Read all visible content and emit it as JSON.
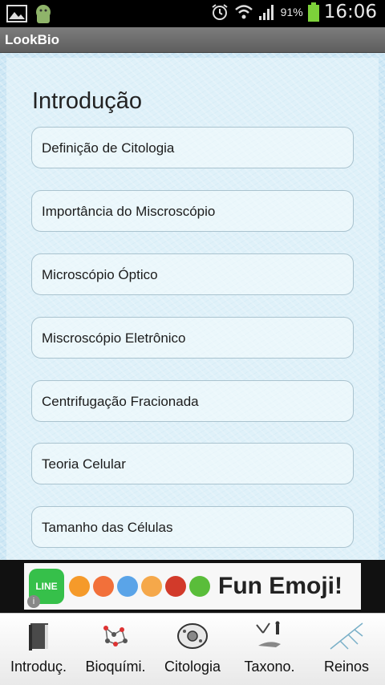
{
  "status_bar": {
    "battery_percent": "91%",
    "time": "16:06",
    "icons": [
      "gallery-icon",
      "android-icon",
      "alarm-icon",
      "wifi-icon",
      "signal-icon",
      "battery-icon"
    ]
  },
  "app": {
    "title": "LookBio"
  },
  "main": {
    "heading": "Introdução",
    "items": [
      {
        "label": "Definição de Citologia"
      },
      {
        "label": "Importância do Miscroscópio"
      },
      {
        "label": "Microscópio Óptico"
      },
      {
        "label": "Miscroscópio Eletrônico"
      },
      {
        "label": "Centrifugação Fracionada"
      },
      {
        "label": "Teoria Celular"
      },
      {
        "label": "Tamanho das Células"
      }
    ]
  },
  "ad": {
    "logo_text": "LINE",
    "text": "Fun Emoji!",
    "info": "i"
  },
  "tabs": [
    {
      "label": "Introduç.",
      "icon": "book-icon"
    },
    {
      "label": "Bioquími.",
      "icon": "molecule-icon"
    },
    {
      "label": "Citologia",
      "icon": "cell-icon"
    },
    {
      "label": "Taxono.",
      "icon": "evolution-icon"
    },
    {
      "label": "Reinos",
      "icon": "tree-icon"
    }
  ]
}
